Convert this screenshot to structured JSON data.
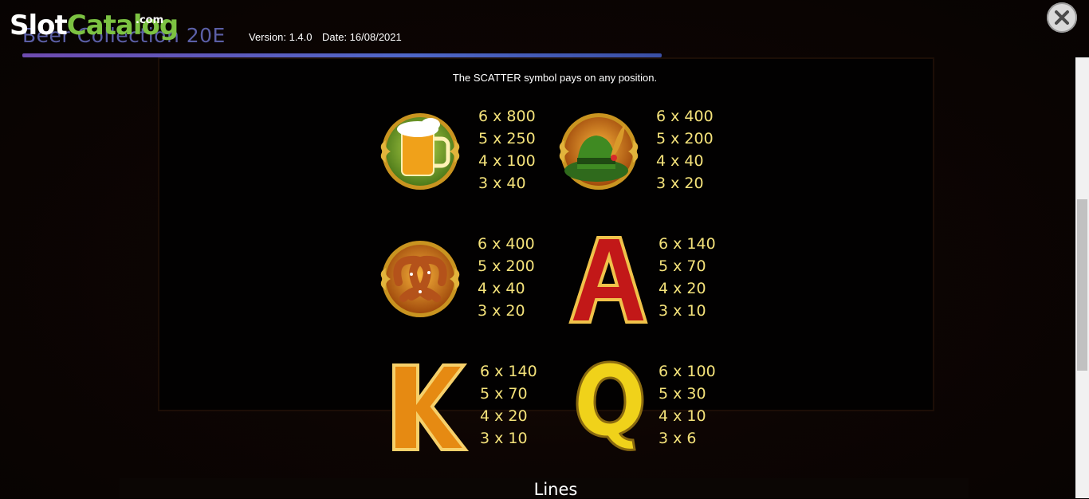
{
  "header": {
    "logo": {
      "slot": "Slot",
      "catalog": "Catalog",
      "com": ".com"
    },
    "game_title": "Beer Collection 20E",
    "version": "Version: 1.4.0",
    "date": "Date: 16/08/2021"
  },
  "scatter_note": "The SCATTER symbol pays on any position.",
  "symbols": [
    {
      "icon": "beer-mug-icon",
      "pays": [
        "6 x 800",
        "5 x 250",
        "4 x 100",
        "3 x 40"
      ]
    },
    {
      "icon": "green-hat-icon",
      "pays": [
        "6 x 400",
        "5 x 200",
        "4 x 40",
        "3 x 20"
      ]
    },
    {
      "icon": "pretzel-icon",
      "pays": [
        "6 x 400",
        "5 x 200",
        "4 x 40",
        "3 x 20"
      ]
    },
    {
      "icon": "letter-a-icon",
      "pays": [
        "6 x 140",
        "5 x 70",
        "4 x 20",
        "3 x 10"
      ]
    },
    {
      "icon": "letter-k-icon",
      "pays": [
        "6 x 140",
        "5 x 70",
        "4 x 20",
        "3 x 10"
      ]
    },
    {
      "icon": "letter-q-icon",
      "pays": [
        "6 x 100",
        "5 x 30",
        "4 x 10",
        "3 x 6"
      ]
    }
  ],
  "section_heading": "Lines",
  "colors": {
    "pay_text": "#f4e27a",
    "divider": "#5a5fc0",
    "logo_green": "#7cc242"
  }
}
